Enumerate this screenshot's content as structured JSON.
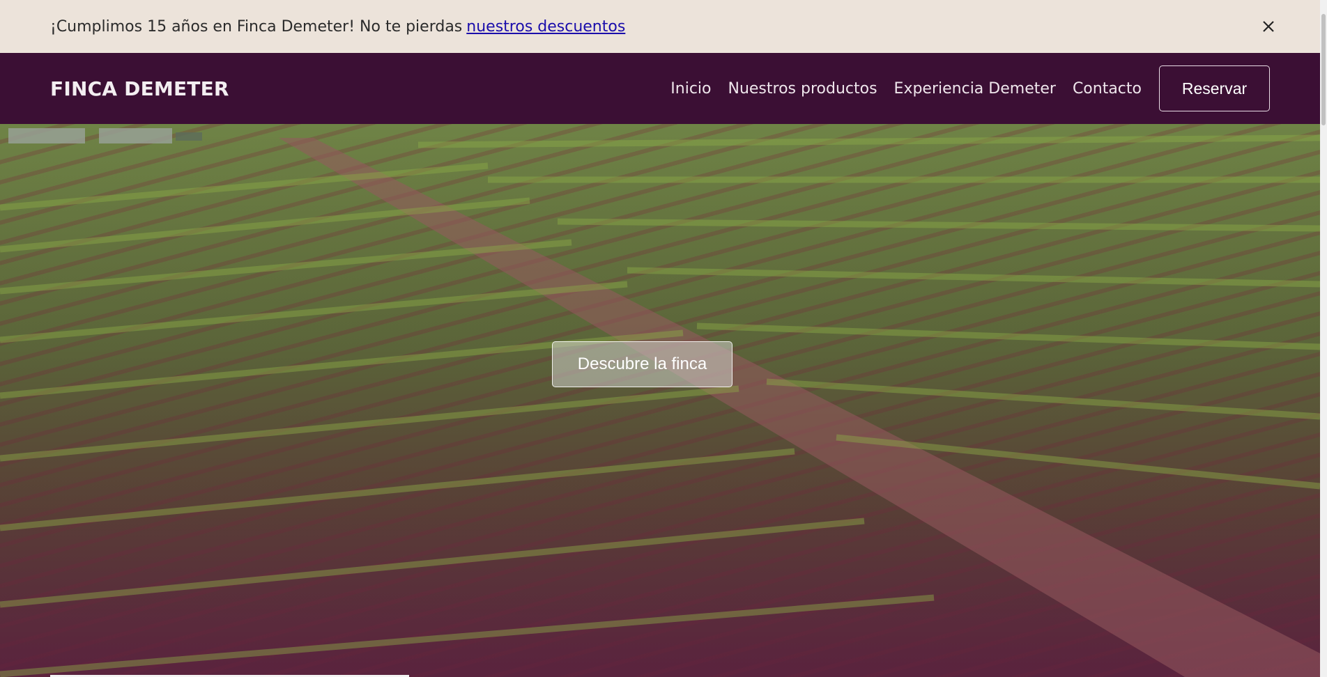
{
  "announcement": {
    "text": "¡Cumplimos 15 años en Finca Demeter! No te pierdas",
    "link": "nuestros descuentos",
    "close_icon": "close-icon"
  },
  "header": {
    "brand": "FINCA DEMETER",
    "nav": [
      "Inicio",
      "Nuestros productos",
      "Experiencia Demeter",
      "Contacto"
    ],
    "cta": "Reservar"
  },
  "hero": {
    "button": "Descubre la finca"
  },
  "colors": {
    "announcement_bg": "#ece3da",
    "header_bg": "#3b0f34",
    "link": "#1a0dab"
  }
}
